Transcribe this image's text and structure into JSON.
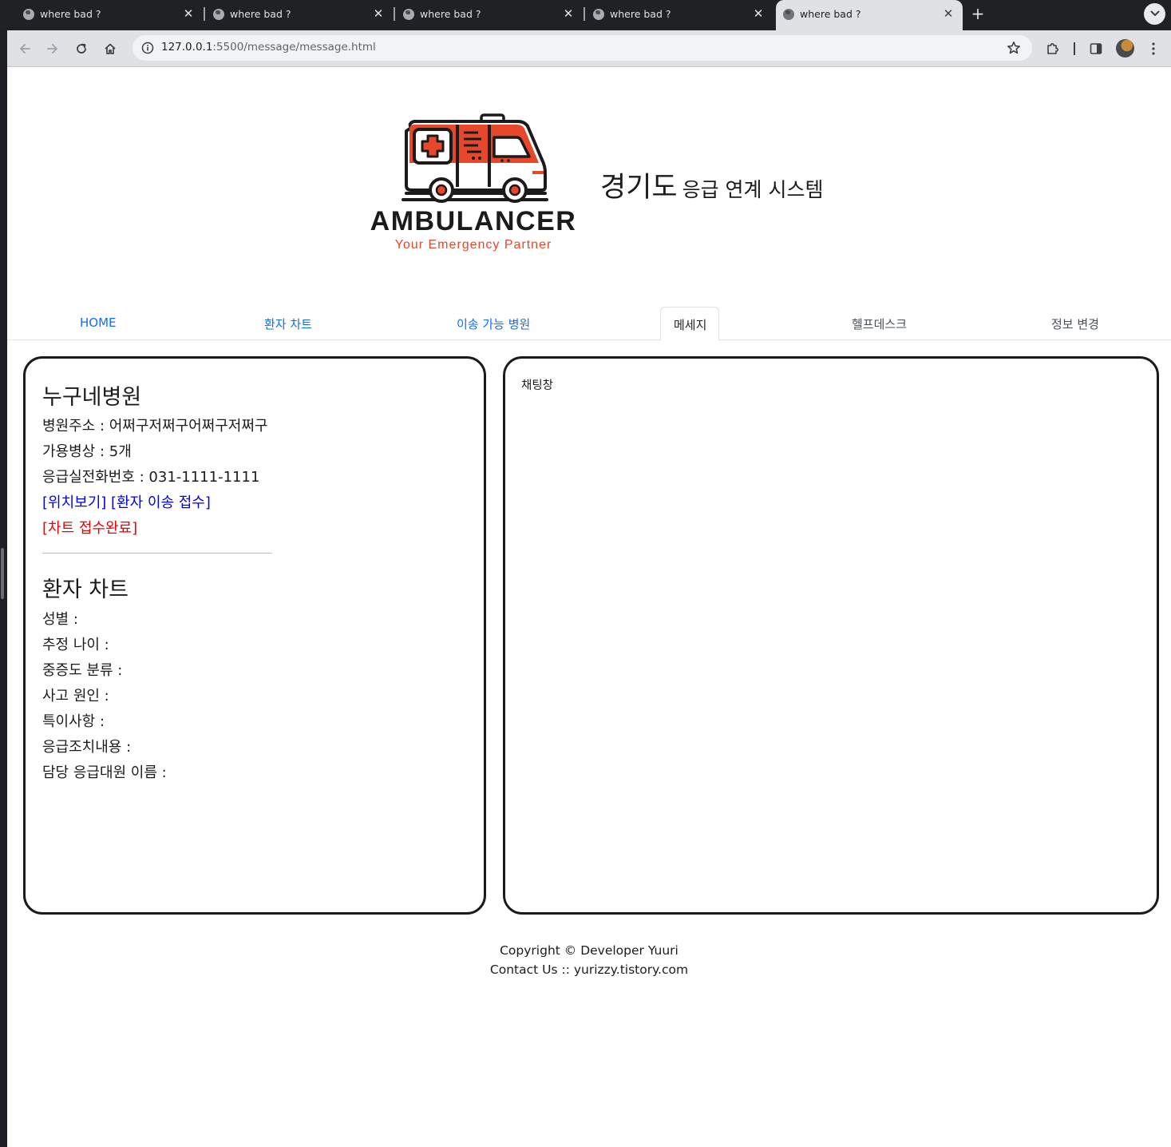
{
  "browser": {
    "tabs": [
      {
        "title": "where bad ?",
        "active": false
      },
      {
        "title": "where bad ?",
        "active": false
      },
      {
        "title": "where bad ?",
        "active": false
      },
      {
        "title": "where bad ?",
        "active": false
      },
      {
        "title": "where bad ?",
        "active": true
      }
    ],
    "close_glyph": "✕",
    "new_tab_glyph": "+",
    "url_host": "127.0.0.1",
    "url_rest": ":5500/message/message.html"
  },
  "header": {
    "logo_text": "AMBULANCER",
    "logo_tagline": "Your Emergency Partner",
    "title_main": "경기도",
    "title_sub": "응급 연계 시스템",
    "colors": {
      "logo_red": "#e8472a",
      "logo_dark": "#1b1b1b"
    }
  },
  "nav": {
    "items": [
      {
        "label": "HOME",
        "active": false
      },
      {
        "label": "환자 차트",
        "active": false
      },
      {
        "label": "이송 가능 병원",
        "active": false
      },
      {
        "label": "메세지",
        "active": true
      },
      {
        "label": "헬프데스크",
        "active": false
      },
      {
        "label": "정보 변경",
        "active": false
      }
    ],
    "colors": {
      "link": "#0d6efd",
      "muted": "#495057"
    }
  },
  "hospital": {
    "name": "누구네병원",
    "address_line": "병원주소 : 어쩌구저쩌구어쩌구저쩌구",
    "beds_line": "가용병상 : 5개",
    "phone_line": "응급실전화번호 : 031-1111-1111",
    "location_link": "[위치보기]",
    "transfer_link": "[환자 이송 접수]",
    "chart_done_link": "[차트 접수완료]"
  },
  "patient_chart": {
    "title": "환자 차트",
    "fields": [
      "성별 :",
      "추정 나이 :",
      "중증도 분류 :",
      "사고 원인 :",
      "특이사항 :",
      "응급조치내용 :",
      "담당 응급대원 이름 :"
    ]
  },
  "chat": {
    "label": "채팅창"
  },
  "footer": {
    "copyright": "Copyright © Developer Yuuri",
    "contact": "Contact Us :: yurizzy.tistory.com"
  }
}
